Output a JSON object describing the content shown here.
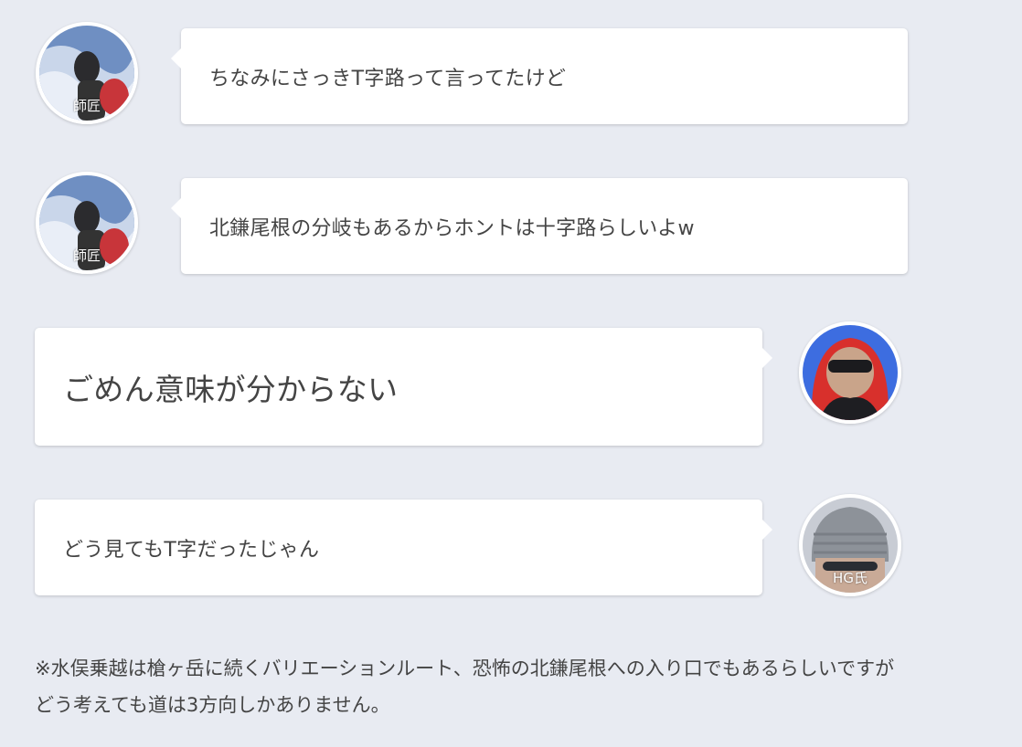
{
  "messages": [
    {
      "speaker": "師匠",
      "side": "left",
      "text": "ちなみにさっきT字路って言ってたけど"
    },
    {
      "speaker": "師匠",
      "side": "left",
      "text": "北鎌尾根の分岐もあるからホントは十字路らしいよw"
    },
    {
      "speaker": "",
      "side": "right",
      "text": "ごめん意味が分からない"
    },
    {
      "speaker": "HG氏",
      "side": "right",
      "text": "どう見てもT字だったじゃん"
    }
  ],
  "note": "※水俣乗越は槍ヶ岳に続くバリエーションルート、恐怖の北鎌尾根への入り口でもあるらしいですがどう考えても道は3方向しかありません。",
  "colors": {
    "background": "#e8ebf2",
    "bubble": "#ffffff",
    "text": "#444444"
  }
}
